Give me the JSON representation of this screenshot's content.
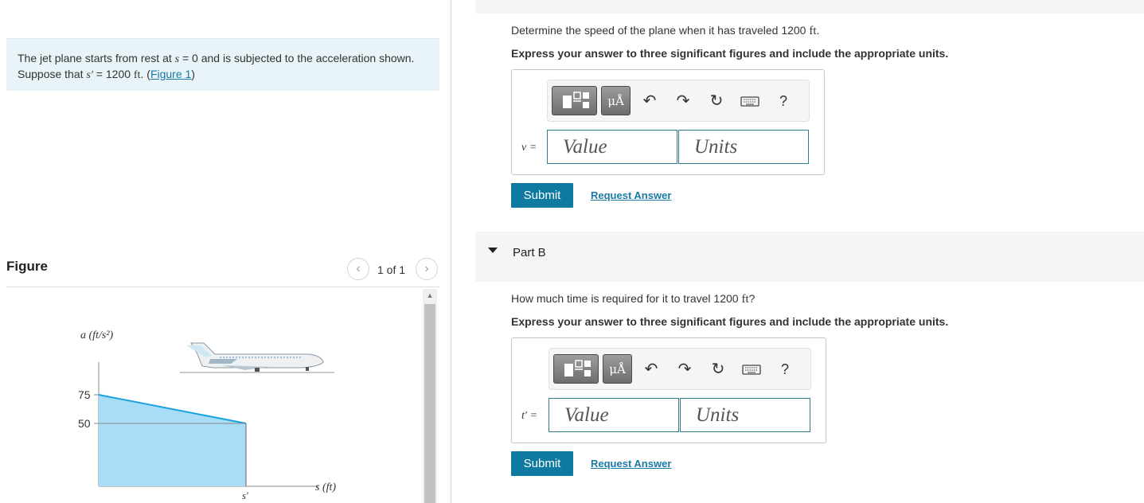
{
  "problem": {
    "text_before": "The jet plane starts from rest at ",
    "s_var": "s",
    "text_mid": " = 0 and is subjected to the acceleration shown. Suppose that ",
    "s_prime_var": "s′",
    "text_after": " = 1200 ",
    "unit": "ft",
    "link_open": ". (",
    "figure_link": "Figure 1",
    "link_close": ")"
  },
  "figure": {
    "title": "Figure",
    "counter": "1 of 1",
    "prev_icon": "chevron-left-icon",
    "next_icon": "chevron-right-icon"
  },
  "chart_data": {
    "type": "area",
    "ylabel": "a (ft/s²)",
    "xlabel": "s (ft)",
    "y_ticks": [
      "75",
      "50"
    ],
    "x_tick": "s′",
    "points": [
      {
        "x": "0",
        "y": 75
      },
      {
        "x": "s′",
        "y": 50
      }
    ]
  },
  "part_a": {
    "question_before": "Determine the speed of the plane when it has traveled 1200 ",
    "question_unit": "ft",
    "question_after": ".",
    "instruction": "Express your answer to three significant figures and include the appropriate units.",
    "var_label": "v =",
    "value_placeholder": "Value",
    "units_placeholder": "Units",
    "submit": "Submit",
    "request": "Request Answer"
  },
  "part_b": {
    "header": "Part B",
    "question_before": "How much time is required for it to travel 1200 ",
    "question_unit": "ft",
    "question_after": "?",
    "instruction": "Express your answer to three significant figures and include the appropriate units.",
    "var_label": "t′ =",
    "value_placeholder": "Value",
    "units_placeholder": "Units",
    "submit": "Submit",
    "request": "Request Answer"
  },
  "toolbar": {
    "units_label": "μÅ",
    "help_label": "?",
    "icons": [
      "templates-icon",
      "units-icon",
      "undo-icon",
      "redo-icon",
      "reset-icon",
      "keyboard-icon",
      "help-icon"
    ]
  },
  "colors": {
    "accent": "#0f7aa0",
    "problem_bg": "#e8f4f7",
    "area_fill": "#a9dcf7",
    "area_line": "#1aa3e0"
  }
}
